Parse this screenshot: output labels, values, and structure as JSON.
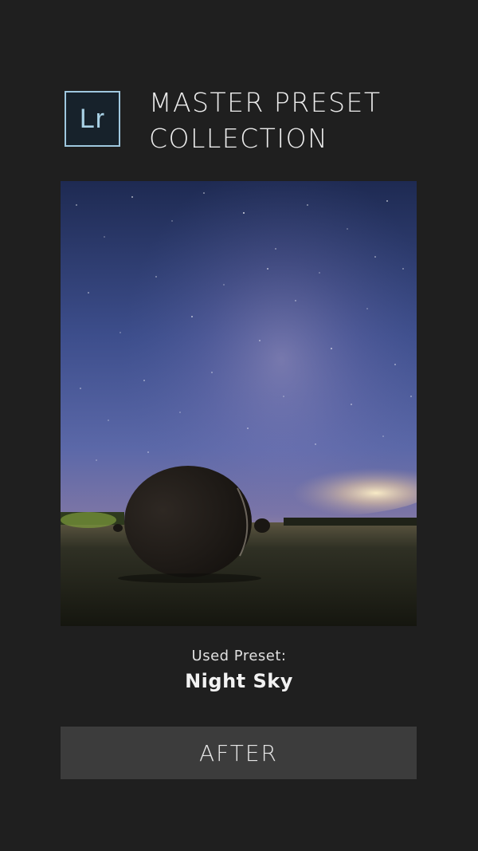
{
  "logo": {
    "text": "Lr"
  },
  "header": {
    "title_line1": "MASTER PRESET",
    "title_line2": "COLLECTION"
  },
  "preset": {
    "label": "Used Preset:",
    "name": "Night Sky"
  },
  "toggle": {
    "label": "AFTER"
  },
  "colors": {
    "background": "#1f1f1f",
    "logo_border": "#9fc8df",
    "button_bg": "#3c3c3c",
    "text": "#ececec"
  }
}
